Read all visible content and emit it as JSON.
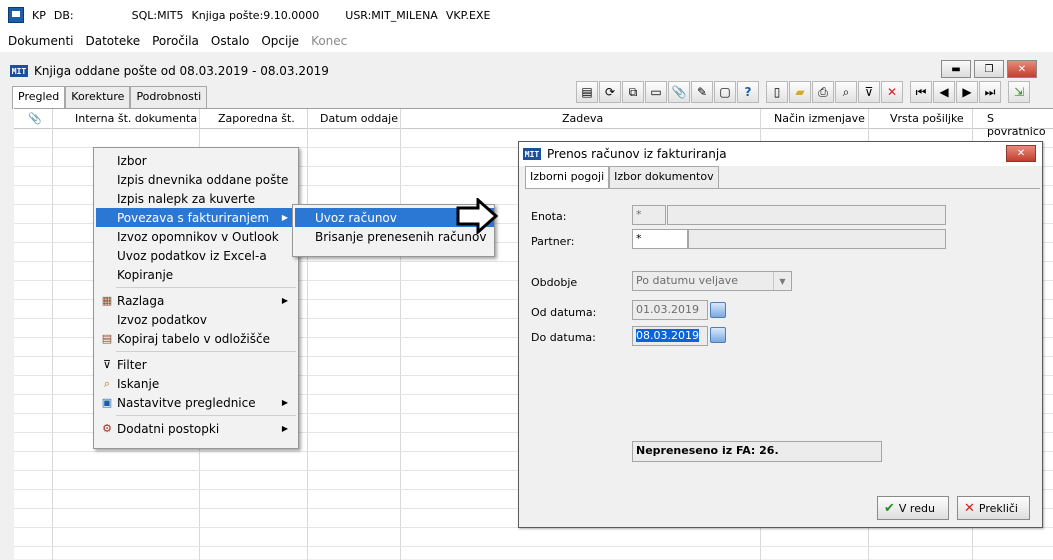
{
  "app": {
    "title_parts": [
      "KP",
      "DB:",
      "SQL:MIT5",
      "Knjiga pošte:9.10.0000",
      "USR:MIT_MILENA",
      "VKP.EXE"
    ]
  },
  "menubar": {
    "items": [
      "Dokumenti",
      "Datoteke",
      "Poročila",
      "Ostalo",
      "Opcije"
    ],
    "disabled_item": "Konec"
  },
  "child_window": {
    "logo": "MIT",
    "title": "Knjiga oddane  pošte od 08.03.2019 - 08.03.2019",
    "tabs": [
      "Pregled",
      "Korekture",
      "Podrobnosti"
    ],
    "active_tab": "Pregled"
  },
  "grid": {
    "columns": [
      "Interna št. dokumenta",
      "Zaporedna št.",
      "Datum oddaje",
      "Zadeva",
      "Način izmenjave",
      "Vrsta pošiljke",
      "S povratnico"
    ]
  },
  "context_menu": {
    "items": [
      {
        "label": "Izbor"
      },
      {
        "label": "Izpis dnevnika oddane pošte"
      },
      {
        "label": "Izpis nalepk za kuverte"
      },
      {
        "label": "Povezava s fakturiranjem",
        "submenu": true,
        "highlighted": true
      },
      {
        "label": "Izvoz opomnikov v Outlook"
      },
      {
        "label": "Uvoz podatkov iz Excel-a"
      },
      {
        "label": "Kopiranje"
      },
      {
        "label": "Razlaga",
        "submenu": true,
        "icon": "breakdown-icon"
      },
      {
        "label": "Izvoz podatkov"
      },
      {
        "label": "Kopiraj tabelo v odložišče",
        "icon": "clipboard-icon"
      },
      {
        "label": "Filter",
        "icon": "filter-icon"
      },
      {
        "label": "Iskanje",
        "icon": "magnifier-icon"
      },
      {
        "label": "Nastavitve preglednice",
        "submenu": true,
        "icon": "grid-settings-icon"
      },
      {
        "label": "Dodatni postopki",
        "submenu": true,
        "icon": "gears-icon"
      }
    ]
  },
  "submenu": {
    "items": [
      "Uvoz računov",
      "Brisanje prenesenih računov"
    ]
  },
  "dialog": {
    "logo": "MIT",
    "title": "Prenos računov iz fakturiranja",
    "tabs": [
      "Izborni pogoji",
      "Izbor dokumentov"
    ],
    "enota_label": "Enota:",
    "enota_value": "*",
    "partner_label": "Partner:",
    "partner_value": "*",
    "obdobje_label": "Obdobje",
    "obdobje_value": "Po datumu veljave",
    "od_label": "Od datuma:",
    "od_value": "01.03.2019",
    "do_label": "Do datuma:",
    "do_value": "08.03.2019",
    "status": "Nepreneseno iz FA: 26.",
    "ok_label": "V redu",
    "cancel_label": "Prekliči"
  },
  "colors": {
    "highlight": "#2a78d4",
    "close_red": "#c0402e"
  }
}
